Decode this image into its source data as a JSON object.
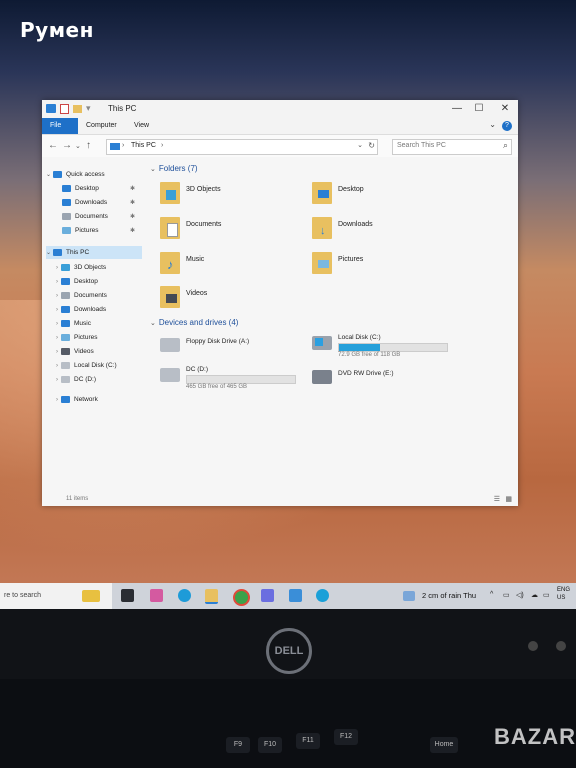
{
  "overlay": {
    "title": "Румен"
  },
  "window": {
    "title": "This PC",
    "controls": {
      "minimize": "—",
      "maximize": "☐",
      "close": "✕"
    },
    "ribbon_tabs": [
      "File",
      "Computer",
      "View"
    ],
    "help": "?",
    "address": "This PC",
    "search_placeholder": "Search This PC",
    "sidebar": {
      "quick_access": "Quick access",
      "quick_items": [
        "Desktop",
        "Downloads",
        "Documents",
        "Pictures"
      ],
      "this_pc": "This PC",
      "pc_items": [
        "3D Objects",
        "Desktop",
        "Documents",
        "Downloads",
        "Music",
        "Pictures",
        "Videos",
        "Local Disk (C:)",
        "DC (D:)"
      ],
      "network": "Network"
    },
    "folders_header": "Folders (7)",
    "folders": [
      "3D Objects",
      "Desktop",
      "Documents",
      "Downloads",
      "Music",
      "Pictures",
      "Videos"
    ],
    "devices_header": "Devices and drives (4)",
    "drives": [
      {
        "name": "Floppy Disk Drive (A:)"
      },
      {
        "name": "Local Disk (C:)",
        "free": "72.9 GB free of 118 GB",
        "used_fraction": 0.38
      },
      {
        "name": "DC (D:)",
        "free": "465 GB free of 465 GB",
        "used_fraction": 0.0
      },
      {
        "name": "DVD RW Drive (E:)"
      }
    ],
    "status": "11 items"
  },
  "taskbar": {
    "search_text": "re to search",
    "weather": "2 cm of rain Thu",
    "lang_top": "ENG",
    "lang_bottom": "US"
  },
  "monitor": {
    "logo": "DELL"
  },
  "keys": [
    "F9",
    "F10",
    "F11",
    "F12",
    "Home"
  ],
  "watermark": "BAZAR"
}
